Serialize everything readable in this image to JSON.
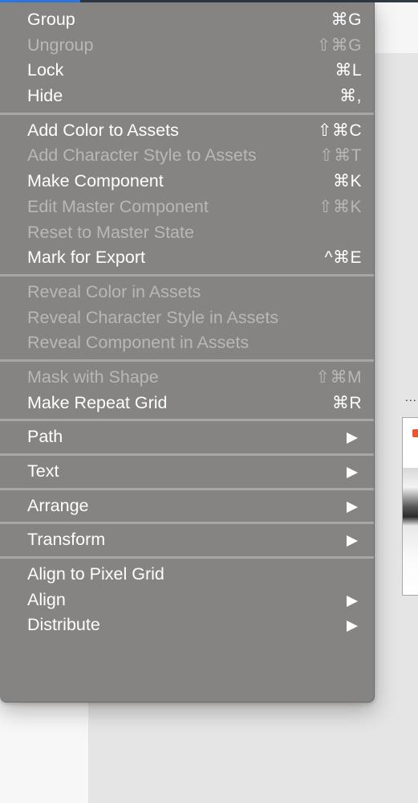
{
  "colors": {
    "menu_bg": "#858483",
    "enabled_text": "#ffffff",
    "disabled_text": "#b9b8b7",
    "accent_bar": "#2e7ff0",
    "artboard_logo": "#f0542a"
  },
  "canvas": {
    "artboard_menu_label": "..."
  },
  "menu": {
    "sections": [
      {
        "items": [
          {
            "label": "Group",
            "shortcut": "⌘G",
            "enabled": true
          },
          {
            "label": "Ungroup",
            "shortcut": "⇧⌘G",
            "enabled": false
          },
          {
            "label": "Lock",
            "shortcut": "⌘L",
            "enabled": true
          },
          {
            "label": "Hide",
            "shortcut": "⌘,",
            "enabled": true
          }
        ]
      },
      {
        "items": [
          {
            "label": "Add Color to Assets",
            "shortcut": "⇧⌘C",
            "enabled": true
          },
          {
            "label": "Add Character Style to Assets",
            "shortcut": "⇧⌘T",
            "enabled": false
          },
          {
            "label": "Make Component",
            "shortcut": "⌘K",
            "enabled": true
          },
          {
            "label": "Edit Master Component",
            "shortcut": "⇧⌘K",
            "enabled": false
          },
          {
            "label": "Reset to Master State",
            "shortcut": "",
            "enabled": false
          },
          {
            "label": "Mark for Export",
            "shortcut": "^⌘E",
            "enabled": true
          }
        ]
      },
      {
        "items": [
          {
            "label": "Reveal Color in Assets",
            "shortcut": "",
            "enabled": false
          },
          {
            "label": "Reveal Character Style in Assets",
            "shortcut": "",
            "enabled": false
          },
          {
            "label": "Reveal Component in Assets",
            "shortcut": "",
            "enabled": false
          }
        ]
      },
      {
        "items": [
          {
            "label": "Mask with Shape",
            "shortcut": "⇧⌘M",
            "enabled": false
          },
          {
            "label": "Make Repeat Grid",
            "shortcut": "⌘R",
            "enabled": true
          }
        ]
      },
      {
        "items": [
          {
            "label": "Path",
            "submenu": true,
            "enabled": true
          }
        ]
      },
      {
        "items": [
          {
            "label": "Text",
            "submenu": true,
            "enabled": true
          }
        ]
      },
      {
        "items": [
          {
            "label": "Arrange",
            "submenu": true,
            "enabled": true
          }
        ]
      },
      {
        "items": [
          {
            "label": "Transform",
            "submenu": true,
            "enabled": true
          }
        ]
      },
      {
        "items": [
          {
            "label": "Align to Pixel Grid",
            "shortcut": "",
            "enabled": true
          },
          {
            "label": "Align",
            "submenu": true,
            "enabled": true
          },
          {
            "label": "Distribute",
            "submenu": true,
            "enabled": true
          }
        ]
      }
    ]
  }
}
